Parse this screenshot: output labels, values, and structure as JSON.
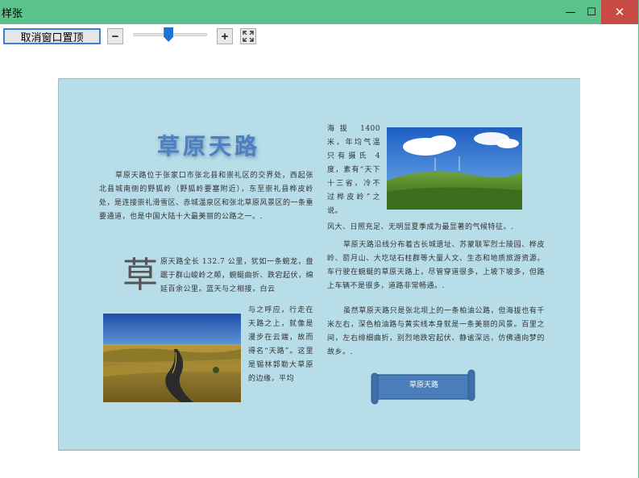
{
  "window": {
    "title": "样张",
    "min_glyph": "—",
    "max_glyph": "☐",
    "close_glyph": "✕"
  },
  "toolbar": {
    "toggle_topmost_label": "取消窗口置顶",
    "zoom_out_label": "−",
    "zoom_in_label": "+",
    "zoom_level": 0.48,
    "fullscreen_icon": "fullscreen-icon"
  },
  "document": {
    "title": "草原天路",
    "drop_cap": "草",
    "col1_p1": "草原天路位于张家口市张北县和崇礼区的交界处，西起张北县城南侧的野狐岭（野狐岭要塞附近），东至崇礼县桦皮岭处，是连接崇礼滑雪区、赤城温泉区和张北草原风景区的一条重要通道，也是中国大陆十大最美丽的公路之一。.",
    "col1_p2a": "原天路全长 132.7 公里，犹如一条蜿龙，盘踞于群山峻岭之颠，蜿蜒曲折、跌宕起伏，绵延百余公里。蓝天与之相接，白云",
    "col1_p2b": "与之呼应，行走在天路之上，就像是漫步在云端，故而得名“天路”。这里是锡林郭勒大草原的边缘，平均",
    "col2_p1": "海拔 1400 米，年均气温只有摄氏 4 度，素有“天下十三省，冷不过桦皮岭”之说。",
    "col2_p1b": "风大、日照充足、无明显夏季成为最显著的气候特征。.",
    "col2_p2": "草原天路沿线分布着古长城遗址、苏蒙联军烈士陵园、桦皮岭、箭月山、大圪垯石柱群等大量人文、生态和地质旅游资源。车行驶在蜿蜒的草原天路上，尽管穿道很多，上坡下坡多，但路上车辆不是很多，道路非常畅通。.",
    "col2_p3": "虽然草原天路只是张北坝上的一条柏油公路，但海拔也有千米左右，深色柏油路与黄实线本身就是一条美丽的风景。百里之间，左右绯细曲折，别烈地跌宕起伏、静谧深远，仿佛通向梦的故乡。.",
    "scroll_label": "草原天路"
  },
  "colors": {
    "titlebar": "#5cc28b",
    "close": "#c74a44",
    "doc_bg": "#b7dde8",
    "title_blue": "#4d7fc1",
    "scroll_blue": "#4a7ebb"
  }
}
